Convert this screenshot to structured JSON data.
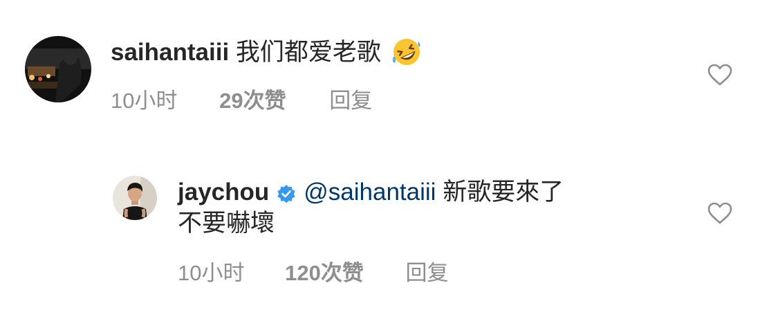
{
  "comments": [
    {
      "username": "saihantaiii",
      "text": "我们都爱老歌",
      "emoji_icon": "rolling-on-floor-laughing-emoji",
      "time": "10小时",
      "likes": "29次赞",
      "reply_label": "回复",
      "like_icon": "heart-outline-icon"
    },
    {
      "username": "jaychou",
      "verified_icon": "verified-badge-icon",
      "mention": "@saihantaiii",
      "text_line1": "新歌要來了",
      "text_line2": "不要嚇壞",
      "time": "10小时",
      "likes": "120次赞",
      "reply_label": "回复",
      "like_icon": "heart-outline-icon"
    }
  ],
  "colors": {
    "text": "#262626",
    "secondary": "#8e8e8e",
    "mention": "#00376b",
    "verified": "#3897f0",
    "background": "#ffffff"
  }
}
